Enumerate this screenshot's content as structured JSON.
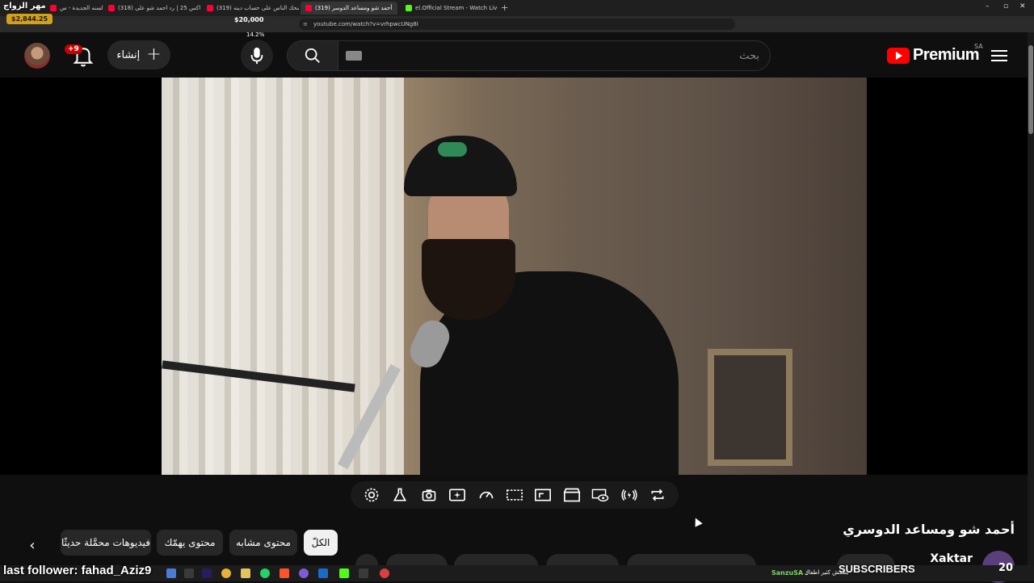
{
  "browser": {
    "tabs": [
      {
        "label": "اول بث في السنه الجديدة - س"
      },
      {
        "label": "(318) لاعانة اكس 25 | رد احمد شو على"
      },
      {
        "label": "(319) يضحك الناس على حساب دينه !!"
      },
      {
        "label": "(319) أحمد شو ومساعد الدوسر",
        "active": true
      },
      {
        "label": "el.Official Stream - Watch Live on Ki"
      }
    ],
    "new_tab": "+",
    "url": "youtube.com/watch?v=vrhpwcUNg8I",
    "window_controls": [
      "–",
      "▫",
      "✕"
    ]
  },
  "overlay": {
    "marriage_text": "مهر الزواج",
    "price_badge": "$2,844.25",
    "price_goal": "$20,000",
    "percent": "14.2%",
    "last_follower": "last follower: fahad_Aziz9",
    "subscribers_label": "SUBSCRIBERS",
    "subscribers_count": "20",
    "chat_user": "SanzuSA :",
    "chat_message": "يطفش كثير اطفال"
  },
  "header": {
    "logo_text": "Premium",
    "country_code": "SA",
    "search_placeholder": "بحث",
    "create_label": "إنشاء",
    "notifications_badge": "+9"
  },
  "video": {
    "title": "أحمد شو ومساعد الدوسري",
    "channel": "Xaktar"
  },
  "chips": [
    {
      "label": "الكلّ",
      "active": true
    },
    {
      "label": "محتوى مشابه"
    },
    {
      "label": "محتوى يهمّك"
    },
    {
      "label": "فيديوهات محمَّلة حديثًا"
    }
  ],
  "colors": {
    "youtube_red": "#ff0000",
    "badge_gold": "#d4a017",
    "chip_active_bg": "#f1f1f1"
  },
  "icons": [
    "menu-icon",
    "youtube-logo-icon",
    "search-icon",
    "mic-icon",
    "plus-icon",
    "bell-icon",
    "keyboard-icon",
    "settings-icon",
    "flask-icon",
    "camera-icon",
    "sparkle-icon",
    "speed-icon",
    "frame-icon",
    "resize-icon",
    "clapper-icon",
    "eye-icon",
    "broadcast-icon",
    "loop-icon",
    "chevron-left-icon"
  ]
}
